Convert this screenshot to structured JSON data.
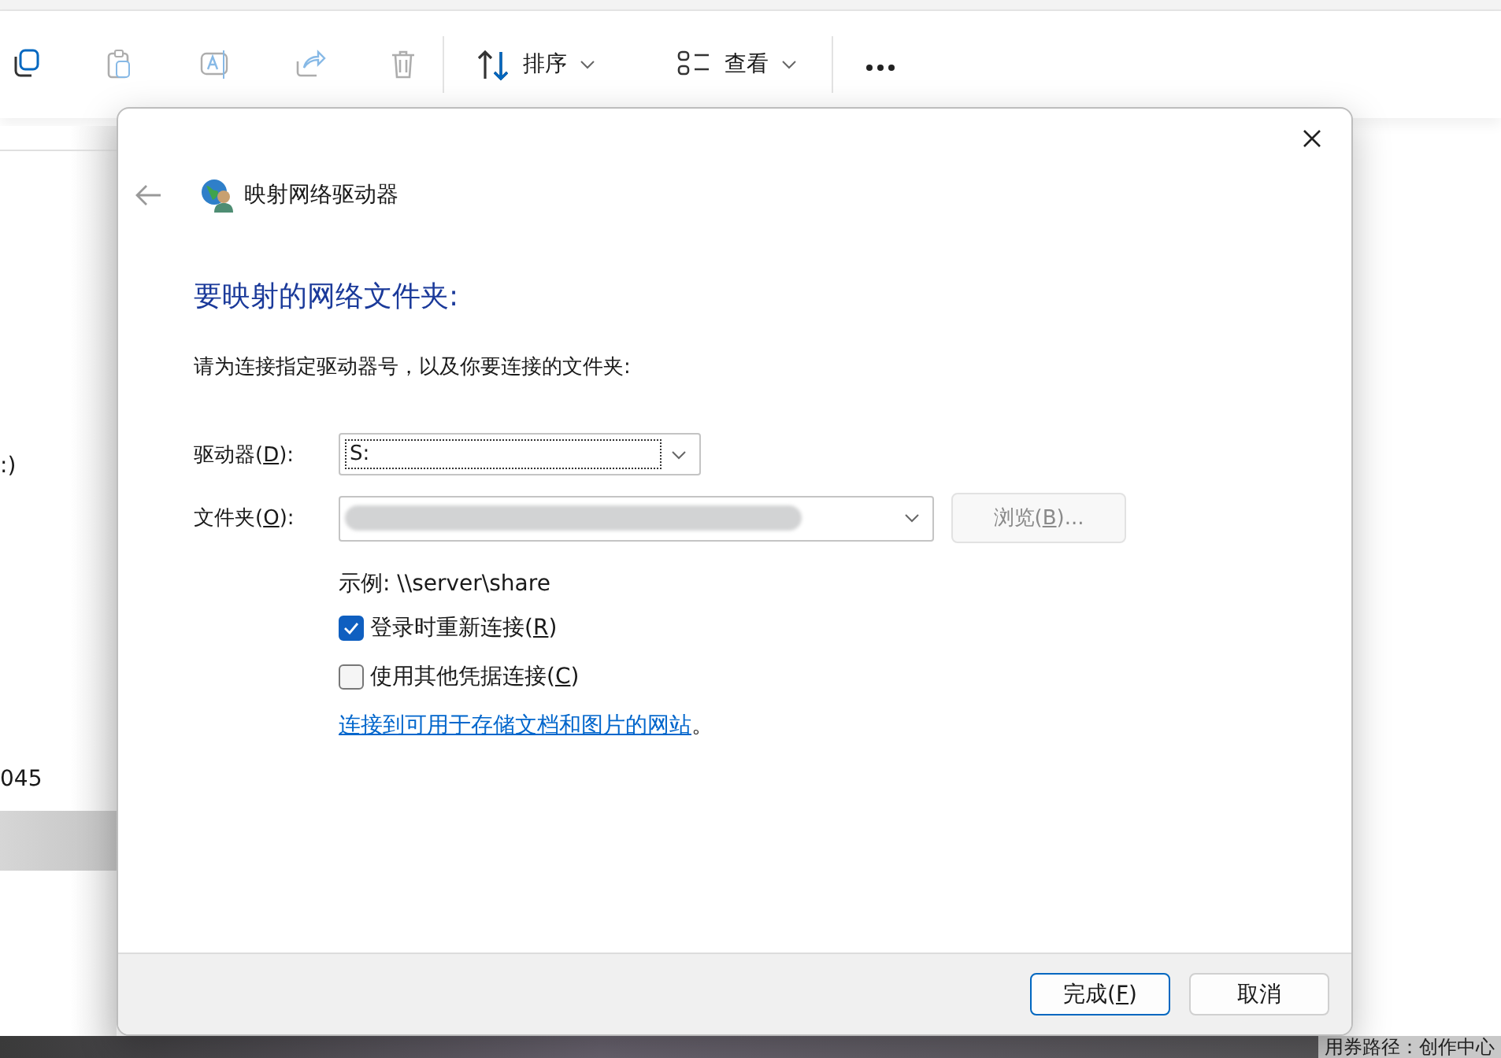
{
  "explorer": {
    "actions": [
      {
        "kind": "copy",
        "disabled": false
      },
      {
        "kind": "paste",
        "disabled": true
      },
      {
        "kind": "rename",
        "disabled": true
      },
      {
        "kind": "share",
        "disabled": true
      },
      {
        "kind": "delete",
        "disabled": true
      }
    ],
    "menus": [
      {
        "kind": "sort",
        "label": "排序"
      },
      {
        "kind": "view",
        "label": "查看"
      }
    ],
    "items": [
      {
        "label": ":)",
        "selected": false
      },
      {
        "label": "045",
        "selected": false
      },
      {
        "selected": true
      }
    ],
    "bottom_text": "用券路径：创作中心"
  },
  "dialog": {
    "title": "映射网络驱动器",
    "heading": "要映射的网络文件夹:",
    "instruction": "请为连接指定驱动器号，以及你要连接的文件夹:",
    "drive": {
      "label": [
        "驱动器(",
        "D",
        "):"
      ],
      "value": "S:",
      "focused": true
    },
    "folder": {
      "label": [
        "文件夹(",
        "O",
        "):"
      ]
    },
    "browse": {
      "label": [
        "浏览(",
        "B",
        ")..."
      ],
      "disabled": true
    },
    "example": "示例: \\\\server\\share",
    "options": [
      {
        "label": [
          "登录时重新连接(",
          "R",
          ")"
        ],
        "checked": true
      },
      {
        "label": [
          "使用其他凭据连接(",
          "C",
          ")"
        ],
        "checked": false
      }
    ],
    "link": {
      "text": "连接到可用于存储文档和图片的网站",
      "after": "。"
    },
    "buttons": [
      {
        "label": [
          "完成(",
          "F",
          ")"
        ],
        "default": true
      },
      {
        "label": [
          "取消"
        ],
        "default": false
      }
    ]
  }
}
